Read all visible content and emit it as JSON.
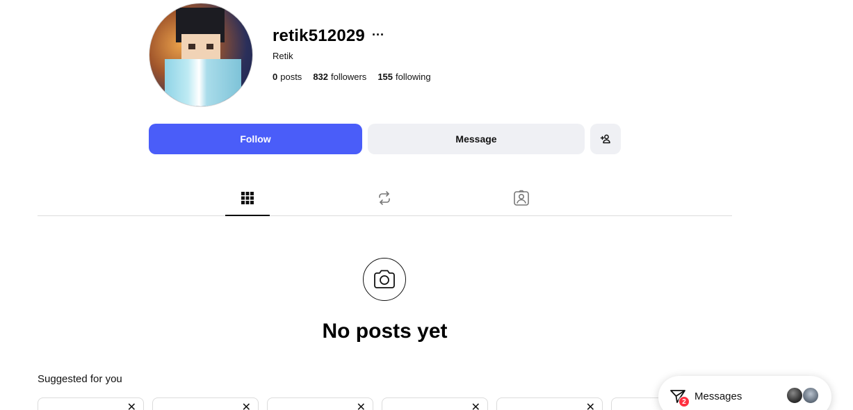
{
  "profile": {
    "username": "retik512029",
    "display_name": "Retik",
    "more_label": "···",
    "stats": {
      "posts_count": "0",
      "posts_label": "posts",
      "followers_count": "832",
      "followers_label": "followers",
      "following_count": "155",
      "following_label": "following"
    }
  },
  "actions": {
    "follow_label": "Follow",
    "message_label": "Message",
    "add_user_icon": "add-user-icon"
  },
  "tabs": [
    {
      "icon": "grid-icon",
      "active": true
    },
    {
      "icon": "reposts-icon",
      "active": false
    },
    {
      "icon": "tagged-icon",
      "active": false
    }
  ],
  "empty_state": {
    "icon": "camera-icon",
    "title": "No posts yet"
  },
  "suggestions": {
    "label": "Suggested for you",
    "close_glyph": "✕"
  },
  "messages": {
    "label": "Messages",
    "badge_count": "2"
  },
  "colors": {
    "accent": "#4a5df9",
    "secondary_button": "#eff0f4",
    "badge": "#ff3040"
  }
}
